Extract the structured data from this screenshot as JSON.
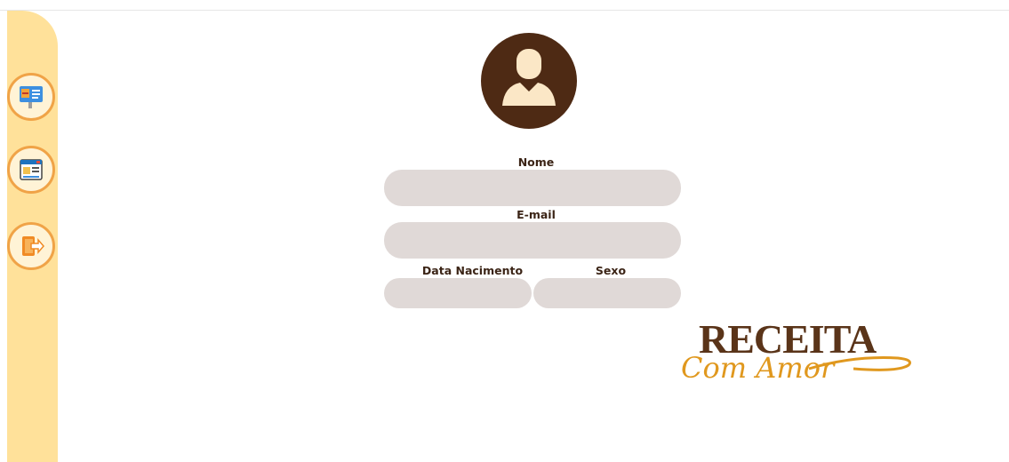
{
  "sidebar": {
    "items": [
      {
        "icon": "recipe-board-icon"
      },
      {
        "icon": "recipe-book-icon"
      },
      {
        "icon": "logout-icon"
      }
    ]
  },
  "profile": {
    "avatar_icon": "user-avatar-icon"
  },
  "form": {
    "name_label": "Nome",
    "name_value": "",
    "email_label": "E-mail",
    "email_value": "",
    "birth_label": "Data Nacimento",
    "birth_value": "",
    "sex_label": "Sexo",
    "sex_value": ""
  },
  "logo": {
    "line1": "RECEITA",
    "line2": "Com Amor"
  },
  "colors": {
    "sidebar_bg": "#ffe19a",
    "accent_orange": "#f0a347",
    "brown": "#4e2a14",
    "field_bg": "#e0d9d7"
  }
}
